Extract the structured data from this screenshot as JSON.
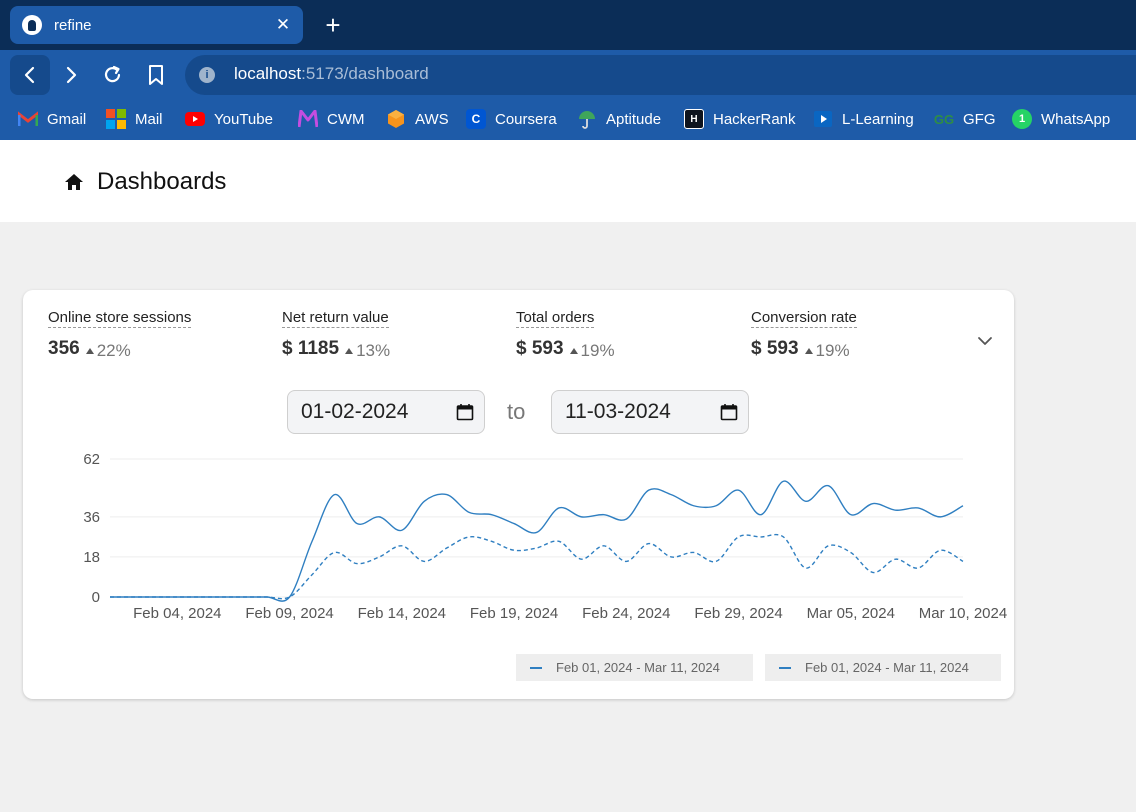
{
  "browser": {
    "tab_title": "refine",
    "tab_close": "✕",
    "new_tab": "+",
    "url_host": "localhost",
    "url_rest": ":5173/dashboard",
    "bookmarks": [
      {
        "label": "Gmail",
        "icon": "gmail-icon"
      },
      {
        "label": "Mail",
        "icon": "microsoft-icon"
      },
      {
        "label": "YouTube",
        "icon": "youtube-icon"
      },
      {
        "label": "CWM",
        "icon": "cwm-icon"
      },
      {
        "label": "AWS",
        "icon": "aws-icon"
      },
      {
        "label": "Coursera",
        "icon": "coursera-icon"
      },
      {
        "label": "Aptitude",
        "icon": "umbrella-icon"
      },
      {
        "label": "HackerRank",
        "icon": "hackerrank-icon"
      },
      {
        "label": "L-Learning",
        "icon": "linkedin-learning-icon"
      },
      {
        "label": "GFG",
        "icon": "gfg-icon"
      },
      {
        "label": "WhatsApp",
        "icon": "whatsapp-icon"
      }
    ]
  },
  "header": {
    "title": "Dashboards"
  },
  "kpis": [
    {
      "label": "Online store sessions",
      "value": "356",
      "change": "22%"
    },
    {
      "label": "Net return value",
      "value": "$ 1185",
      "change": "13%"
    },
    {
      "label": "Total orders",
      "value": "$ 593",
      "change": "19%"
    },
    {
      "label": "Conversion rate",
      "value": "$ 593",
      "change": "19%"
    }
  ],
  "date_range": {
    "start": "01-02-2024",
    "separator": "to",
    "end": "11-03-2024"
  },
  "colors": {
    "primary_series": "#2f7fc1",
    "secondary_series": "#2f7fc1",
    "accent": "#1e5ba8"
  },
  "chart_data": {
    "type": "line",
    "y_ticks": [
      0,
      18,
      36,
      62
    ],
    "ylim": [
      0,
      62
    ],
    "x_tick_labels": [
      "Feb 04, 2024",
      "Feb 09, 2024",
      "Feb 14, 2024",
      "Feb 19, 2024",
      "Feb 24, 2024",
      "Feb 29, 2024",
      "Mar 05, 2024",
      "Mar 10, 2024"
    ],
    "x_start": "Feb 01, 2024",
    "x_end": "Mar 11, 2024",
    "series": [
      {
        "name": "Feb 01, 2024 - Mar 11, 2024",
        "style": "solid",
        "values": [
          0,
          0,
          0,
          0,
          0,
          0,
          0,
          0,
          0,
          25,
          46,
          33,
          36,
          30,
          43,
          46,
          38,
          37,
          33,
          29,
          40,
          36,
          37,
          35,
          48,
          46,
          41,
          41,
          48,
          37,
          52,
          43,
          50,
          37,
          42,
          39,
          40,
          36,
          41
        ]
      },
      {
        "name": "Feb 01, 2024 - Mar 11, 2024",
        "style": "dashed",
        "values": [
          0,
          0,
          0,
          0,
          0,
          0,
          0,
          0,
          0,
          10,
          20,
          15,
          18,
          23,
          16,
          22,
          27,
          25,
          21,
          22,
          25,
          17,
          23,
          16,
          24,
          18,
          20,
          16,
          27,
          27,
          27,
          13,
          23,
          20,
          11,
          17,
          13,
          21,
          16
        ]
      }
    ],
    "legend_position": "bottom-right",
    "grid": "horizontal"
  }
}
